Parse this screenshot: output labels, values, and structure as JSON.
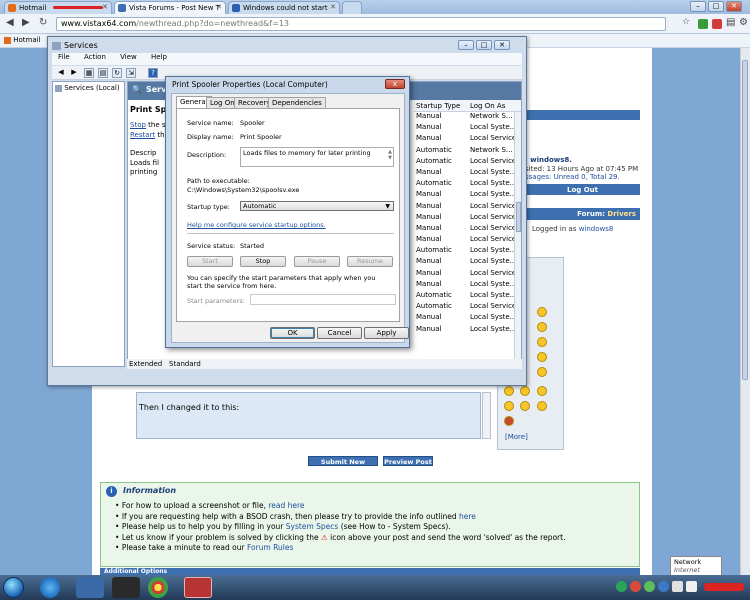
{
  "browser": {
    "tabs": [
      {
        "label": "Hotmail",
        "favicon_color": "#e36b1e"
      },
      {
        "label": "Vista Forums - Post New T",
        "favicon_color": "#3d6fb1"
      },
      {
        "label": "Windows could not start",
        "favicon_color": "#2a5fb3"
      },
      {
        "label": "",
        "favicon_color": "#c9d9ee"
      }
    ],
    "url_domain": "www.vistax64.com",
    "url_rest": "/newthread.php?do=newthread&f=13",
    "bookmark": "Hotmail"
  },
  "services_window": {
    "title": "Services",
    "menu": [
      "File",
      "Action",
      "View",
      "Help"
    ],
    "tree_item": "Services (Local)",
    "header": "Servi",
    "left_panel": {
      "name": "Print Spool",
      "stop_link": "Stop",
      "stop_suffix": " the se",
      "restart_link": "Restart",
      "restart_suffix": " the",
      "desc_label": "Descrip",
      "desc_lines": [
        "Loads fil",
        "printing"
      ]
    },
    "columns": [
      "Startup Type",
      "Log On As"
    ],
    "rows": [
      [
        "Manual",
        "Network S..."
      ],
      [
        "Manual",
        "Local Syste..."
      ],
      [
        "Manual",
        "Local Service"
      ],
      [
        "Automatic",
        "Network S..."
      ],
      [
        "Automatic",
        "Local Service"
      ],
      [
        "Manual",
        "Local Syste..."
      ],
      [
        "Automatic",
        "Local Syste..."
      ],
      [
        "Manual",
        "Local Syste..."
      ],
      [
        "Manual",
        "Local Service"
      ],
      [
        "Manual",
        "Local Service"
      ],
      [
        "Manual",
        "Local Service"
      ],
      [
        "Manual",
        "Local Service"
      ],
      [
        "Automatic",
        "Local Syste..."
      ],
      [
        "Manual",
        "Local Syste..."
      ],
      [
        "Manual",
        "Local Service"
      ],
      [
        "Manual",
        "Local Syste..."
      ],
      [
        "Automatic",
        "Local Syste..."
      ],
      [
        "Automatic",
        "Local Service"
      ],
      [
        "Manual",
        "Local Syste..."
      ],
      [
        "Manual",
        "Local Syste..."
      ]
    ],
    "view_tabs": [
      "Extended",
      "Standard"
    ]
  },
  "dialog": {
    "title": "Print Spooler Properties (Local Computer)",
    "close_label": "x",
    "tabs": [
      "General",
      "Log On",
      "Recovery",
      "Dependencies"
    ],
    "service_name_label": "Service name:",
    "service_name": "Spooler",
    "display_name_label": "Display name:",
    "display_name": "Print Spooler",
    "description_label": "Description:",
    "description": "Loads files to memory for later printing",
    "path_label": "Path to executable:",
    "path": "C:\\Windows\\System32\\spoolsv.exe",
    "startup_type_label": "Startup type:",
    "startup_type": "Automatic",
    "help_link": "Help me configure service startup options.",
    "status_label": "Service status:",
    "status": "Started",
    "buttons_service": [
      "Start",
      "Stop",
      "Pause",
      "Resume"
    ],
    "params_note": "You can specify the start parameters that apply when you start the service from here.",
    "params_label": "Start parameters:",
    "buttons": [
      "OK",
      "Cancel",
      "Apply"
    ]
  },
  "forum": {
    "welcome_user": ", windows8.",
    "last_visited": "sited: 13 Hours Ago at 07:45 PM",
    "messages": "ssages: Unread 0, Total 29.",
    "logout": "Log Out",
    "forum_label": "Forum:",
    "forum_name": "Drivers",
    "logged_in_prefix": "Logged in as",
    "logged_in_user": "windows8",
    "editor_text": "Then I changed it to this:",
    "more_link": "[More]",
    "submit_button": "Submit New Thread",
    "preview_button": "Preview Post",
    "info_title": "Information",
    "info_lines": [
      {
        "text": "For how to upload a screenshot or file, ",
        "link": "read here",
        "after": ""
      },
      {
        "text": "If you are requesting help with a BSOD crash, then please try to provide the info outlined ",
        "link": "here",
        "after": ""
      },
      {
        "text": "Please help us to help you by filling in your ",
        "link": "System Specs",
        "after": " (see How to - System Specs)."
      },
      {
        "text": "Let us know if your problem is solved by clicking the ",
        "link": "",
        "after": " icon above your post and send the word 'solved' as the report."
      },
      {
        "text": "Please take a minute to read our ",
        "link": "Forum Rules",
        "after": ""
      }
    ],
    "additional_options": "Additional Options"
  },
  "tooltip": {
    "line1": "Network",
    "line2": "Internet access"
  },
  "colors": {
    "accent": "#3d6fb1",
    "info_bg": "#eaf6ea",
    "dialog_bg": "#f0f0f0"
  }
}
